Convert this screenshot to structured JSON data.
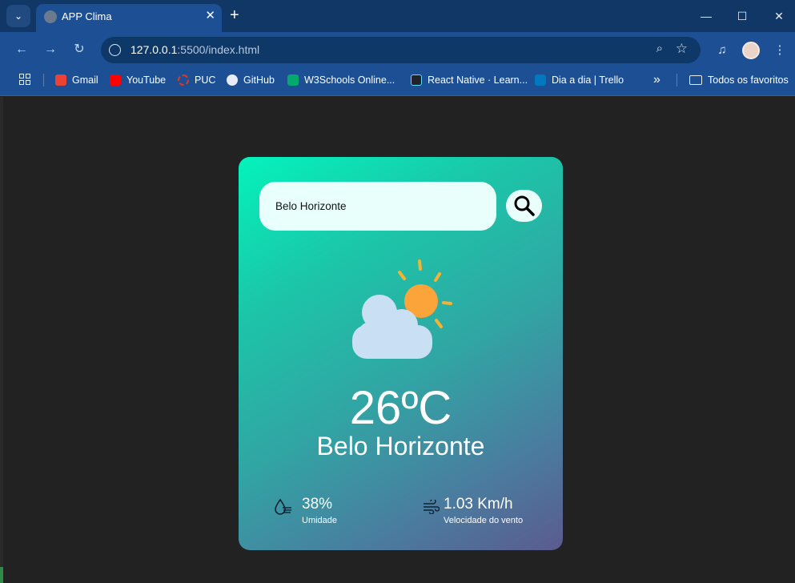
{
  "browser": {
    "tab_title": "APP Clima",
    "tab_close": "✕",
    "new_tab": "+",
    "url_host": "127.0.0.1",
    "url_path": ":5500/index.html",
    "bookmarks": [
      {
        "label": "Gmail",
        "icon": "gmail-icon",
        "color": "#ea4335"
      },
      {
        "label": "YouTube",
        "icon": "youtube-icon",
        "color": "#ff0000"
      },
      {
        "label": "PUC",
        "icon": "puc-icon",
        "color": "#d63b2f"
      },
      {
        "label": "GitHub",
        "icon": "github-icon",
        "color": "#1b1f23"
      },
      {
        "label": "W3Schools Online...",
        "icon": "w3schools-icon",
        "color": "#04aa6d"
      },
      {
        "label": "React Native · Learn...",
        "icon": "react-icon",
        "color": "#20232a"
      },
      {
        "label": "Dia a dia | Trello",
        "icon": "trello-icon",
        "color": "#0079bf"
      }
    ],
    "more_bookmarks": "»",
    "all_bookmarks": "Todos os favoritos"
  },
  "app": {
    "search_value": "Belo Horizonte",
    "temperature": "26ºC",
    "city": "Belo Horizonte",
    "humidity_value": "38%",
    "humidity_label": "Umidade",
    "wind_value": "1.03 Km/h",
    "wind_label": "Velocidade do vento",
    "weather_icon": "partly-cloudy-icon"
  },
  "colors": {
    "card_gradient_start": "#04f3bc",
    "card_gradient_end": "#5b5b90",
    "chrome_blue": "#1c4f93"
  }
}
